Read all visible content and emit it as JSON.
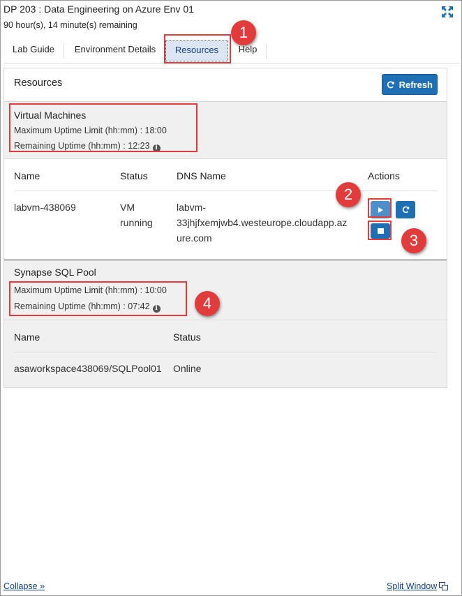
{
  "header": {
    "title": "DP 203 : Data Engineering on Azure Env 01",
    "remaining": "90 hour(s), 14 minute(s) remaining",
    "expand_icon": "expand-arrows-icon"
  },
  "tabs": [
    {
      "label": "Lab Guide"
    },
    {
      "label": "Environment Details"
    },
    {
      "label": "Resources",
      "active": true
    },
    {
      "label": "Help"
    }
  ],
  "resources": {
    "title": "Resources",
    "refresh_label": "Refresh"
  },
  "virtual_machines": {
    "title": "Virtual Machines",
    "max_uptime": "Maximum Uptime Limit (hh:mm) : 18:00",
    "remaining_uptime": "Remaining Uptime (hh:mm) : 12:23",
    "columns": [
      "Name",
      "Status",
      "DNS Name",
      "Actions"
    ],
    "rows": [
      {
        "name": "labvm-438069",
        "status_line1": "VM",
        "status_line2": "running",
        "dns_line1": "labvm-",
        "dns_line2": "33jhjfxemjwb4.westeurope.cloudapp.az",
        "dns_line3": "ure.com"
      }
    ]
  },
  "sql_pool": {
    "title": "Synapse SQL Pool",
    "max_uptime": "Maximum Uptime Limit (hh:mm) : 10:00",
    "remaining_uptime": "Remaining Uptime (hh:mm) : 07:42",
    "columns": [
      "Name",
      "Status"
    ],
    "rows": [
      {
        "name": "asaworkspace438069/SQLPool01",
        "status": "Online"
      }
    ]
  },
  "badges": [
    "1",
    "2",
    "3",
    "4"
  ],
  "footer": {
    "collapse": "Collapse »",
    "split_window": "Split Window"
  },
  "colors": {
    "accent": "#1f6fb5",
    "highlight": "#e23b3b",
    "section_bg": "#f0f0f0",
    "link": "#16418a"
  }
}
